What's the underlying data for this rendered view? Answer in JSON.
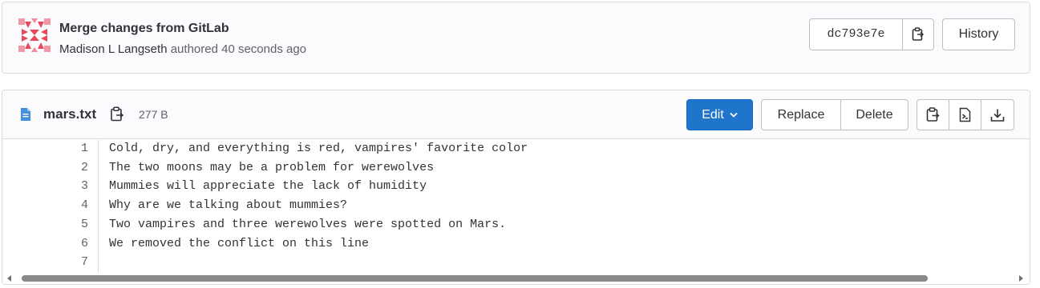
{
  "commit": {
    "title": "Merge changes from GitLab",
    "author": "Madison L Langseth",
    "authored_text": "authored 40 seconds ago",
    "sha": "dc793e7e",
    "history_label": "History",
    "avatar_color": "#e7485b"
  },
  "file": {
    "name": "mars.txt",
    "size": "277 B",
    "edit_label": "Edit",
    "replace_label": "Replace",
    "delete_label": "Delete",
    "icons": [
      "copy-contents-icon",
      "open-raw-icon",
      "download-icon"
    ]
  },
  "code": {
    "lines": [
      {
        "no": "1",
        "text": "Cold, dry, and everything is red, vampires' favorite color"
      },
      {
        "no": "2",
        "text": "The two moons may be a problem for werewolves"
      },
      {
        "no": "3",
        "text": "Mummies will appreciate the lack of humidity"
      },
      {
        "no": "4",
        "text": "Why are we talking about mummies?"
      },
      {
        "no": "5",
        "text": "Two vampires and three werewolves were spotted on Mars."
      },
      {
        "no": "6",
        "text": "We removed the conflict on this line"
      },
      {
        "no": "7",
        "text": ""
      }
    ]
  },
  "colors": {
    "primary": "#1f75cb",
    "border": "#dcdcde",
    "file_icon": "#428fdc"
  }
}
